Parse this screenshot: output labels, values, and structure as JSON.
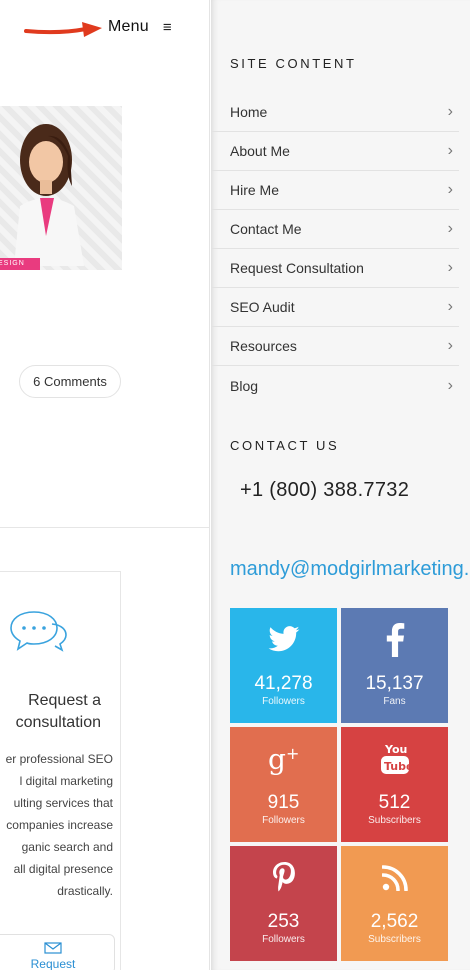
{
  "header": {
    "menu_label": "Menu",
    "menu_icon": "≡"
  },
  "hero": {
    "band_text": "ESIGN"
  },
  "post": {
    "comments_label": "6 Comments"
  },
  "service_card": {
    "title_line1": "Request a",
    "title_line2": "consultation",
    "text_lines": [
      "er professional SEO",
      "l digital marketing",
      "ulting services that",
      "companies increase",
      "ganic search and",
      "all digital presence",
      "drastically."
    ],
    "button_label": "Request"
  },
  "drawer": {
    "site_content_title": "SITE CONTENT",
    "nav_items": [
      {
        "label": "Home"
      },
      {
        "label": "About Me"
      },
      {
        "label": "Hire Me"
      },
      {
        "label": "Contact Me"
      },
      {
        "label": "Request Consultation"
      },
      {
        "label": "SEO Audit"
      },
      {
        "label": "Resources"
      },
      {
        "label": "Blog"
      }
    ],
    "chevron": "›",
    "contact_title": "CONTACT US",
    "phone": "+1 (800) 388.7732",
    "email": "mandy@modgirlmarketing.com"
  },
  "social": [
    {
      "network": "twitter",
      "icon": "twitter-icon",
      "count": "41,278",
      "label": "Followers",
      "color": "#29b6ea"
    },
    {
      "network": "facebook",
      "icon": "facebook-icon",
      "count": "15,137",
      "label": "Fans",
      "color": "#5c7ab3"
    },
    {
      "network": "google-plus",
      "icon": "google-plus-icon",
      "count": "915",
      "label": "Followers",
      "color": "#e16e4f"
    },
    {
      "network": "youtube",
      "icon": "youtube-icon",
      "count": "512",
      "label": "Subscribers",
      "color": "#d64242"
    },
    {
      "network": "pinterest",
      "icon": "pinterest-icon",
      "count": "253",
      "label": "Followers",
      "color": "#c4444c"
    },
    {
      "network": "rss",
      "icon": "rss-icon",
      "count": "2,562",
      "label": "Subscribers",
      "color": "#f19a52"
    }
  ],
  "colors": {
    "accent_blue": "#2e9cd8",
    "arrow_red": "#e03a1e",
    "drawer_bg": "#f6f6f6"
  }
}
